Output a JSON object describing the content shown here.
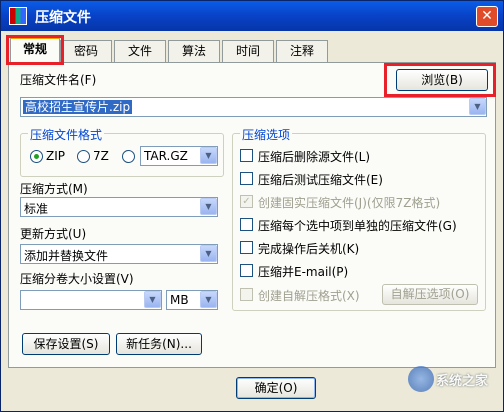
{
  "window": {
    "title": "压缩文件",
    "close_glyph": "✕"
  },
  "tabs": [
    "常规",
    "密码",
    "文件",
    "算法",
    "时间",
    "注释"
  ],
  "archive_name": {
    "label": "压缩文件名(F)",
    "value": "高校招生宣传片.zip",
    "browse_label": "浏览(B)"
  },
  "format_group": {
    "title": "压缩文件格式",
    "options": [
      "ZIP",
      "7Z",
      "TAR.GZ"
    ],
    "selected": "ZIP"
  },
  "compress_method": {
    "label": "压缩方式(M)",
    "value": "标准"
  },
  "update_method": {
    "label": "更新方式(U)",
    "value": "添加并替换文件"
  },
  "split_size": {
    "label": "压缩分卷大小设置(V)",
    "value": "",
    "unit": "MB"
  },
  "left_buttons": {
    "save": "保存设置(S)",
    "new_task": "新任务(N)..."
  },
  "options_group": {
    "title": "压缩选项",
    "items": [
      {
        "label": "压缩后删除源文件(L)",
        "checked": false,
        "disabled": false
      },
      {
        "label": "压缩后测试压缩文件(E)",
        "checked": false,
        "disabled": false
      },
      {
        "label": "创建固实压缩文件(J)(仅限7Z格式)",
        "checked": true,
        "disabled": true
      },
      {
        "label": "压缩每个选中项到单独的压缩文件(G)",
        "checked": false,
        "disabled": false
      },
      {
        "label": "完成操作后关机(K)",
        "checked": false,
        "disabled": false
      },
      {
        "label": "压缩并E-mail(P)",
        "checked": false,
        "disabled": false
      },
      {
        "label": "创建自解压格式(X)",
        "checked": false,
        "disabled": true
      }
    ],
    "sfx_button": "自解压选项(O)"
  },
  "ok_button": "确定(O)",
  "watermark": "系统之家",
  "colors": {
    "title_bar": "#0842c6",
    "highlight": "#e8202a",
    "selection": "#316ac5"
  }
}
